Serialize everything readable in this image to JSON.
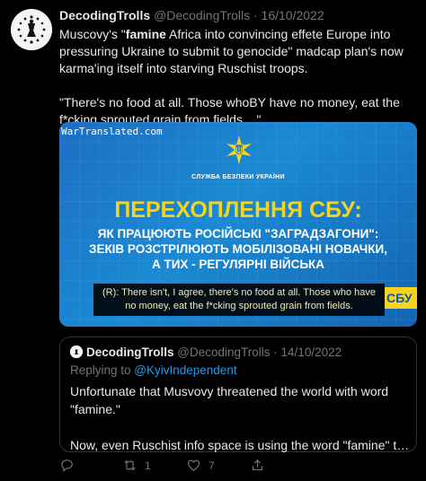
{
  "tweet": {
    "author_name": "DecodingTrolls",
    "author_handle": "@DecodingTrolls",
    "date": "· 16/10/2022",
    "text_line1a": "Muscovy's \"",
    "text_bold": "famine",
    "text_line1b": " Africa into convincing effete Europe into pressuring Ukraine to submit to genocide\" madcap plan's now karma'ing itself into starving Ruschist troops.",
    "text_para2": "\"There's no food at all. Those whoBY have no money, eat the f*cking sprouted grain from fields....\""
  },
  "media": {
    "watermark": "WarTranslated.com",
    "agency": "СЛУЖБА БЕЗПЕКИ УКРАЇНИ",
    "title": "ПЕРЕХОПЛЕННЯ СБУ:",
    "subtitle_1": "ЯК ПРАЦЮЮТЬ РОСІЙСЬКІ \"ЗАГРАДЗАГОНИ\":",
    "subtitle_2": "ЗЕКІВ РОЗСТРІЛЮЮТЬ МОБІЛІЗОВАНІ НОВАЧКИ,",
    "subtitle_3": "А ТИХ - РЕГУЛЯРНІ ВІЙСЬКА",
    "caption": "(R): There isn't, I agree, there's no food at all. Those who have no money, eat the f*cking sprouted grain from fields.",
    "badge": "СБУ"
  },
  "quote": {
    "author_name": "DecodingTrolls",
    "author_handle": "@DecodingTrolls",
    "date": "· 14/10/2022",
    "replying_prefix": "Replying to ",
    "replying_to": "@KyivIndependent",
    "text_para1": "Unfortunate that Musvovy threatened the world with word \"famine.\"",
    "text_para2": "Now, even Ruschist info space is using the word \"famine\" to signi..."
  },
  "actions": {
    "reply_count": "",
    "retweet_count": "1",
    "like_count": "7"
  },
  "colors": {
    "background": "#000000",
    "text": "#e7e9ea",
    "muted": "#71767b",
    "link": "#1d9bf0",
    "sbu_blue": "#1a7ac9",
    "sbu_yellow": "#f6d31c"
  }
}
